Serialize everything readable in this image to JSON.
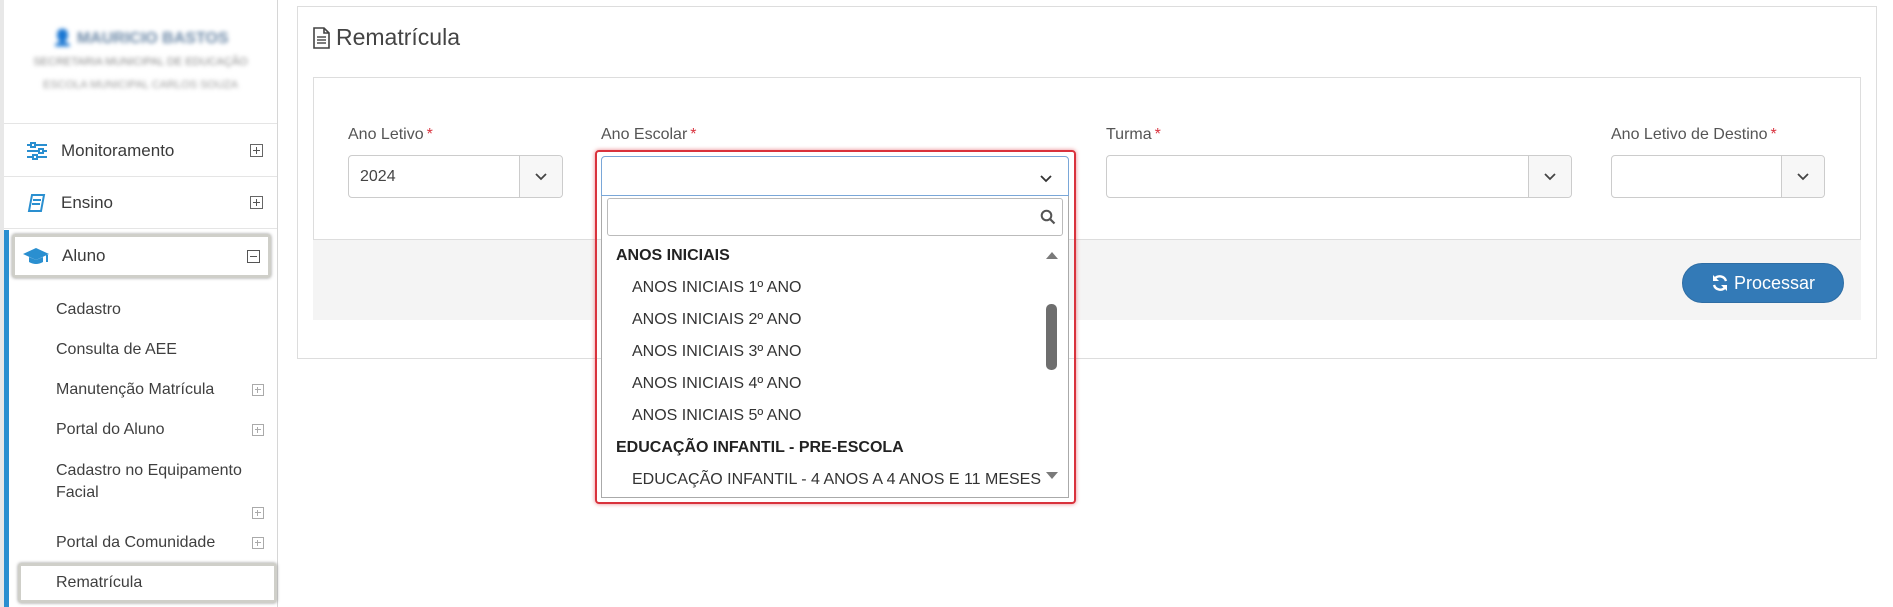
{
  "sidebar": {
    "user": {
      "name": "MAURICIO BASTOS",
      "department": "SECRETARIA MUNICIPAL DE EDUCAÇÃO",
      "school": "ESCOLA MUNICIPAL CARLOS SOUZA"
    },
    "menu": {
      "monitoramento": "Monitoramento",
      "ensino": "Ensino",
      "aluno": "Aluno"
    },
    "submenu": {
      "cadastro": "Cadastro",
      "consulta_aee": "Consulta de AEE",
      "manutencao_matricula": "Manutenção Matrícula",
      "portal_aluno": "Portal do Aluno",
      "cadastro_equipamento": "Cadastro no Equipamento Facial",
      "portal_comunidade": "Portal da Comunidade",
      "rematricula": "Rematrícula"
    }
  },
  "page": {
    "title": "Rematrícula"
  },
  "form": {
    "ano_letivo": {
      "label": "Ano Letivo",
      "value": "2024",
      "required": "*"
    },
    "ano_escolar": {
      "label": "Ano Escolar",
      "value": "",
      "required": "*"
    },
    "turma": {
      "label": "Turma",
      "value": "",
      "required": "*"
    },
    "ano_letivo_destino": {
      "label": "Ano Letivo de Destino",
      "value": "",
      "required": "*"
    },
    "process_button": "Processar"
  },
  "dropdown": {
    "search_value": "",
    "groups": [
      {
        "label": "ANOS INICIAIS",
        "options": [
          "ANOS INICIAIS 1º ANO",
          "ANOS INICIAIS 2º ANO",
          "ANOS INICIAIS 3º ANO",
          "ANOS INICIAIS 4º ANO",
          "ANOS INICIAIS 5º ANO"
        ]
      },
      {
        "label": "EDUCAÇÃO INFANTIL - PRE-ESCOLA",
        "options": [
          "EDUCAÇÃO INFANTIL - 4 ANOS A 4 ANOS E 11 MESES"
        ]
      }
    ]
  },
  "colors": {
    "accent_blue": "#2a8fd0",
    "button_blue": "#337ab7",
    "required_red": "#d9333f",
    "highlight_red": "#d9323c"
  }
}
